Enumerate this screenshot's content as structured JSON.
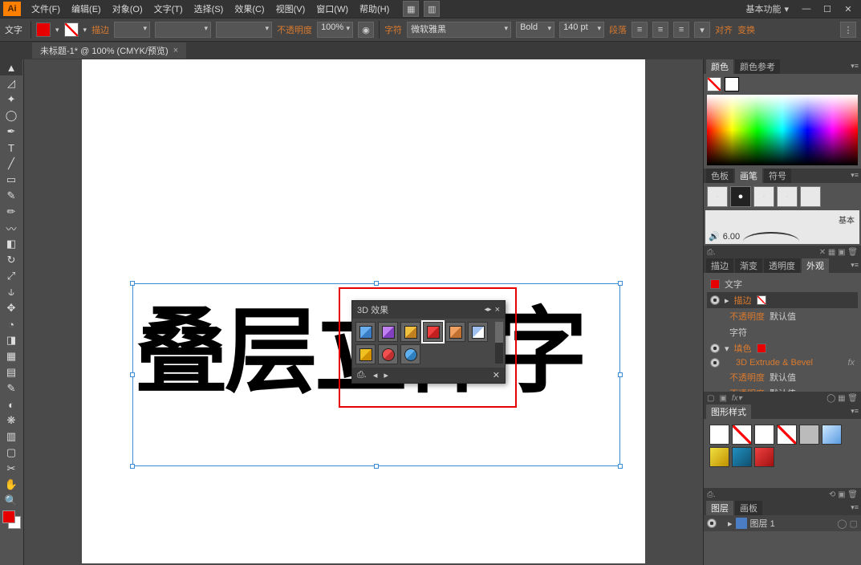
{
  "app": {
    "logo": "Ai"
  },
  "menu": {
    "file": "文件(F)",
    "edit": "编辑(E)",
    "object": "对象(O)",
    "type": "文字(T)",
    "select": "选择(S)",
    "effect": "效果(C)",
    "view": "视图(V)",
    "window": "窗口(W)",
    "help": "帮助(H)"
  },
  "workspace": "基本功能",
  "options": {
    "tool": "文字",
    "stroke": "描边",
    "opacity_label": "不透明度",
    "opacity_val": "100%",
    "char_label": "字符",
    "font": "微软雅黑",
    "weight": "Bold",
    "size": "140 pt",
    "paragraph": "段落",
    "align": "对齐",
    "transform": "变换"
  },
  "doc": {
    "title": "未标题-1* @ 100% (CMYK/预览)"
  },
  "canvas": {
    "text": "叠层立体字"
  },
  "panel3d": {
    "title": "3D 效果"
  },
  "colorPanel": {
    "tab1": "颜色",
    "tab2": "颜色参考"
  },
  "brushPanel": {
    "tab1": "色板",
    "tab2": "画笔",
    "tab3": "符号",
    "basic": "基本",
    "size": "6.00"
  },
  "appearance": {
    "tab1": "描边",
    "tab2": "渐变",
    "tab3": "透明度",
    "tab4": "外观",
    "row_type": "文字",
    "row_stroke": "描边",
    "row_opacity": "不透明度",
    "row_opacity_val": "默认值",
    "row_char": "字符",
    "row_fill": "填色",
    "row_3d": "3D Extrude & Bevel",
    "row_opacity2": "不透明度",
    "row_opacity2_val": "默认值",
    "row_opacity3": "不透明度",
    "row_opacity3_val": "默认值"
  },
  "graphicStyles": {
    "tab": "图形样式"
  },
  "layers": {
    "tab1": "图层",
    "tab2": "画板",
    "name": "图层 1",
    "count": "1"
  }
}
